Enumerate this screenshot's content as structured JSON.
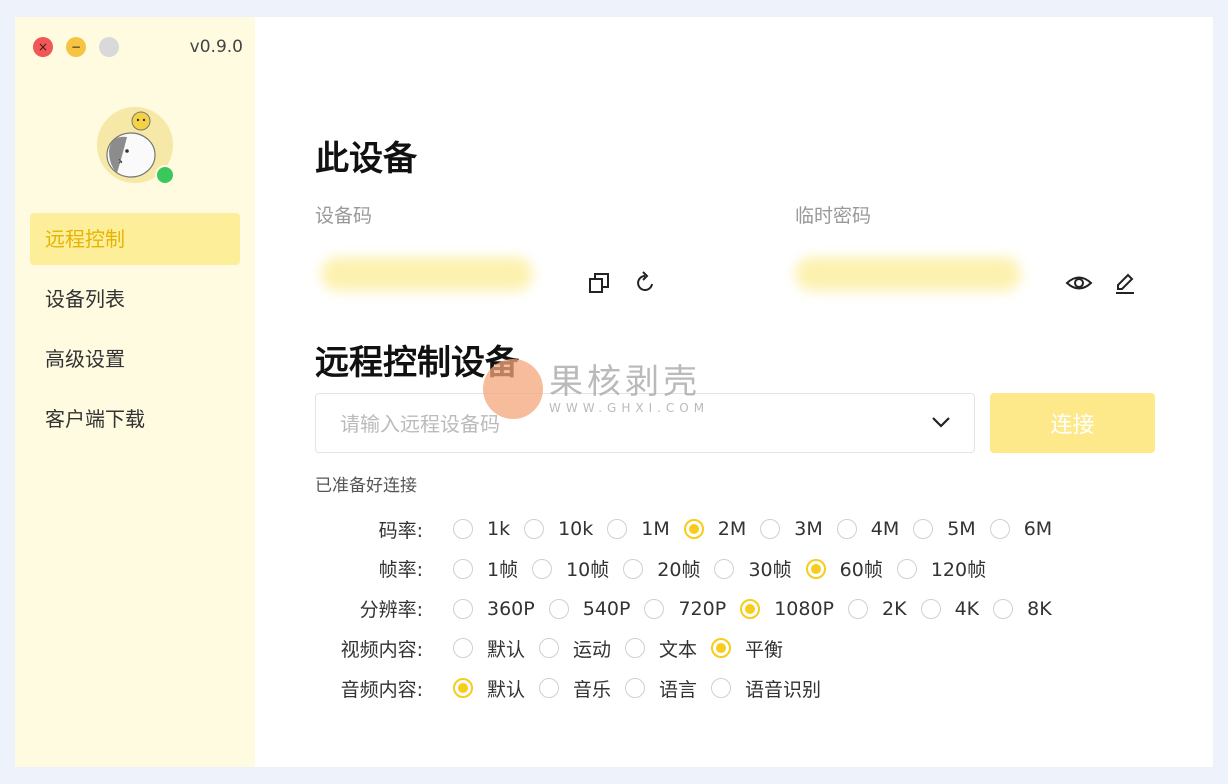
{
  "window": {
    "controls": {
      "close": "×",
      "minimize": "−"
    },
    "version": "v0.9.0"
  },
  "sidebar": {
    "items": [
      {
        "label": "远程控制",
        "active": true
      },
      {
        "label": "设备列表",
        "active": false
      },
      {
        "label": "高级设置",
        "active": false
      },
      {
        "label": "客户端下载",
        "active": false
      }
    ]
  },
  "this_device": {
    "title": "此设备",
    "device_code_label": "设备码",
    "temp_password_label": "临时密码"
  },
  "remote": {
    "title": "远程控制设备",
    "input_placeholder": "请输入远程设备码",
    "connect_label": "连接",
    "status": "已准备好连接"
  },
  "settings": [
    {
      "label": "码率:",
      "options": [
        "1k",
        "10k",
        "1M",
        "2M",
        "3M",
        "4M",
        "5M",
        "6M"
      ],
      "selected": "2M"
    },
    {
      "label": "帧率:",
      "options": [
        "1帧",
        "10帧",
        "20帧",
        "30帧",
        "60帧",
        "120帧"
      ],
      "selected": "60帧"
    },
    {
      "label": "分辨率:",
      "options": [
        "360P",
        "540P",
        "720P",
        "1080P",
        "2K",
        "4K",
        "8K"
      ],
      "selected": "1080P"
    },
    {
      "label": "视频内容:",
      "options": [
        "默认",
        "运动",
        "文本",
        "平衡"
      ],
      "selected": "平衡"
    },
    {
      "label": "音频内容:",
      "options": [
        "默认",
        "音乐",
        "语言",
        "语音识别"
      ],
      "selected": "默认"
    }
  ],
  "watermark": {
    "title": "果核剥壳",
    "url": "WWW.GHXI.COM"
  },
  "colors": {
    "accent": "#f7cc1b",
    "sidebar_bg": "#fefbe0",
    "active_bg": "#fdee9a",
    "button_bg": "#fde98a"
  }
}
